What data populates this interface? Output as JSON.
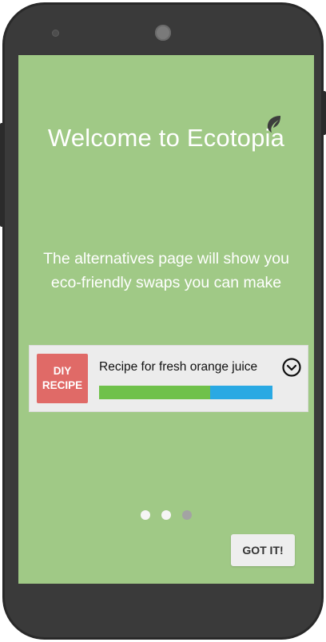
{
  "onboarding": {
    "title": "Welcome to Ecotopia",
    "subtitle": "The alternatives page will show you eco-friendly swaps you can make",
    "page_indicator": {
      "total": 3,
      "current": 2
    },
    "got_it_label": "GOT IT!"
  },
  "card": {
    "badge_line1": "DIY",
    "badge_line2": "RECIPE",
    "title": "Recipe for fresh orange juice",
    "expand_icon": "chevron-down-circle-icon",
    "progress": {
      "green_fraction": 0.64
    }
  },
  "colors": {
    "screen_background": "#a0c986",
    "badge": "#e06a67",
    "progress_green": "#6fc14a",
    "progress_blue": "#2aa9e3",
    "leaf": "#3d3d3d"
  }
}
